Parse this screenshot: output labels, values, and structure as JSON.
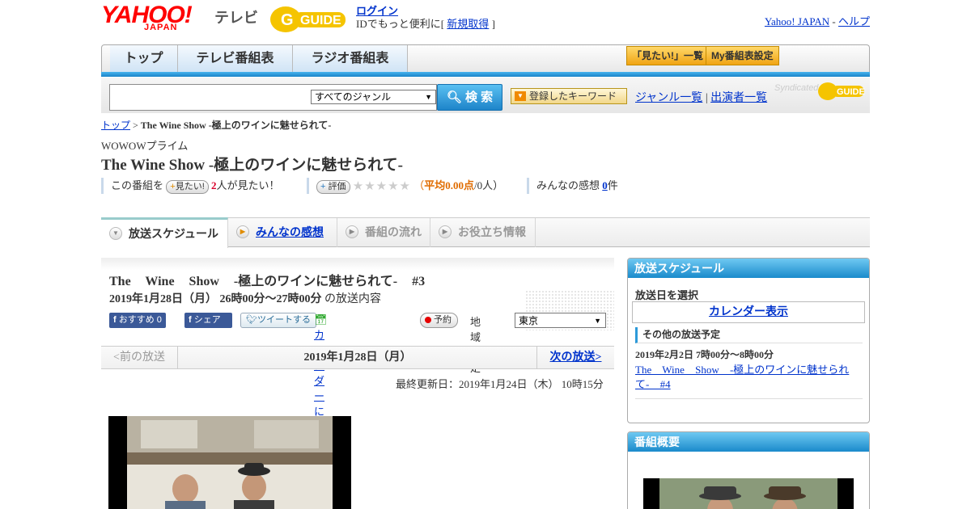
{
  "header": {
    "logo_yahoo": "YAHOO!",
    "logo_japan": "JAPAN",
    "logo_tv": "テレビ",
    "gguide_logo": "GUIDE",
    "login_link": "ログイン",
    "login_text": "IDでもっと便利に[",
    "signup_link": "新規取得",
    "login_close": "]",
    "yahoo_japan_link": "Yahoo! JAPAN",
    "separator": "-",
    "help_link": "ヘルプ"
  },
  "nav": {
    "tabs": [
      "トップ",
      "テレビ番組表",
      "ラジオ番組表"
    ],
    "want_list_button": "「見たい!」一覧",
    "my_schedule_button": "My番組表設定"
  },
  "search": {
    "input_value": "",
    "genre_selected": "すべてのジャンル",
    "search_button": "検 索",
    "keyword_button": "登録したキーワード",
    "genre_list_link": "ジャンル一覧",
    "link_sep": "|",
    "performer_list_link": "出演者一覧",
    "syndicated": "Syndicated"
  },
  "breadcrumb": {
    "top": "トップ",
    "sep": ">",
    "current": "The Wine Show -極上のワインに魅せられて-"
  },
  "program": {
    "channel": "WOWOWプライム",
    "title": "The Wine Show -極上のワインに魅せられて-",
    "want_prefix": "この番組を",
    "want_button": "見たい!",
    "want_count": "2",
    "want_suffix": "人が見たい！",
    "rate_button": "評価",
    "stars": "★★★★★",
    "avg_open": "（",
    "avg_label": "平均0.00点",
    "avg_rest": "/0人）",
    "impressions_label": "みんなの感想",
    "impressions_count": "0",
    "impressions_unit": "件"
  },
  "tabs": [
    {
      "label": "放送スケジュール",
      "icon": "chevron-down-icon"
    },
    {
      "label": "みんなの感想",
      "icon": "play-icon"
    },
    {
      "label": "番組の流れ",
      "icon": "play-icon"
    },
    {
      "label": "お役立ち情報",
      "icon": "play-icon"
    }
  ],
  "episode": {
    "title": "The Wine Show -極上のワインに魅せられて- #3",
    "date": "2019年1月28日（月） 26時00分～27時00分",
    "date_suffix": "の放送内容",
    "recommend_button": "おすすめ 0",
    "share_button": "シェア",
    "tweet_button": "ツイートする",
    "calendar_link": "カレンダーに登録",
    "reserve_button": "予約",
    "region_label": "地域設定",
    "region_selected": "東京"
  },
  "pager": {
    "prev": "<前の放送",
    "current": "2019年1月28日（月）",
    "next": "次の放送>"
  },
  "updated": "最終更新日：2019年1月24日（木） 10時15分",
  "sidebar": {
    "schedule_title": "放送スケジュール",
    "select_date_label": "放送日を選択",
    "calendar_button": "カレンダー表示",
    "other_schedule_label": "その他の放送予定",
    "other_date": "2019年2月2日 7時00分～8時00分",
    "other_link": "The Wine Show -極上のワインに魅せられて- #4",
    "summary_title": "番組概要"
  },
  "colors": {
    "accent_blue": "#1a8acb",
    "link": "#0033cc",
    "orange_button": "#f0a414",
    "want_count": "#d9002b"
  }
}
